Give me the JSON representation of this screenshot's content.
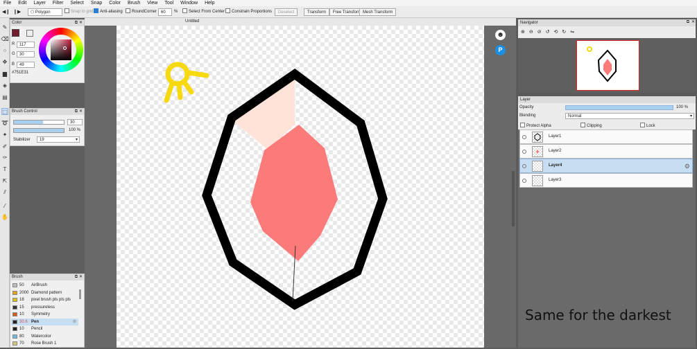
{
  "menubar": [
    "File",
    "Edit",
    "Layer",
    "Filter",
    "Select",
    "Snap",
    "Color",
    "Brush",
    "View",
    "Tool",
    "Window",
    "Help"
  ],
  "toolbar": {
    "tool_select": "Polygon",
    "snap_to_grid": "Snap to grid",
    "anti_aliasing": "Anti-aliasing",
    "round_corner": "RoundCorner",
    "round_value": "60",
    "percent": "%",
    "select_from_center": "Select From Center",
    "constrain_proportions": "Constrain Proportions",
    "deselect": "Deselect",
    "transform": "Transform",
    "free_transform": "Free Transform",
    "mesh_transform": "Mesh Transform"
  },
  "color_panel": {
    "title": "Color",
    "fg_color": "#751E31",
    "r_label": "R",
    "r": "117",
    "g_label": "G",
    "g": "30",
    "b_label": "B",
    "b": "49",
    "hex": "#751E31"
  },
  "brush_control": {
    "title": "Brush Control",
    "size": "30",
    "opacity": "100 %",
    "stabilizer_label": "Stabilizer",
    "stabilizer": "19"
  },
  "brush_panel": {
    "title": "Brush",
    "items": [
      {
        "num": "50",
        "name": "AirBrush",
        "color": "#bdbdbd"
      },
      {
        "num": "2000",
        "name": "Diamond pattern",
        "color": "#e3a21a"
      },
      {
        "num": "18",
        "name": "pixel brush pls pls pls",
        "color": "#d6c01c"
      },
      {
        "num": "15",
        "name": "pressureless",
        "color": "#333333"
      },
      {
        "num": "10",
        "name": "Symmetry",
        "color": "#d65a1e"
      },
      {
        "num": "30.6",
        "name": "Pen",
        "color": "#222222"
      },
      {
        "num": "10",
        "name": "Pencil",
        "color": "#222222"
      },
      {
        "num": "80",
        "name": "Watercolor",
        "color": "#6fb6de"
      },
      {
        "num": "70",
        "name": "Rose Brush 1",
        "color": "#d7c37a"
      }
    ]
  },
  "canvas": {
    "tab_title": "Untitled",
    "caption": "Same for the darkest"
  },
  "navigator": {
    "title": "Navigator"
  },
  "layer_panel": {
    "title": "Layer",
    "opacity_label": "Opacity",
    "opacity": "100 %",
    "blending_label": "Blending",
    "blending": "Normal",
    "protect_alpha": "Protect Alpha",
    "clipping": "Clipping",
    "lock": "Lock",
    "layers": [
      "Layer1",
      "Layer2",
      "Layer4",
      "Layer3"
    ]
  },
  "colors": {
    "gem_outline": "#000000",
    "gem_light": "#ffe3d9",
    "gem_mid": "#fb7a7a",
    "sun": "#f7d90f",
    "accent": "#2a7fd4"
  }
}
